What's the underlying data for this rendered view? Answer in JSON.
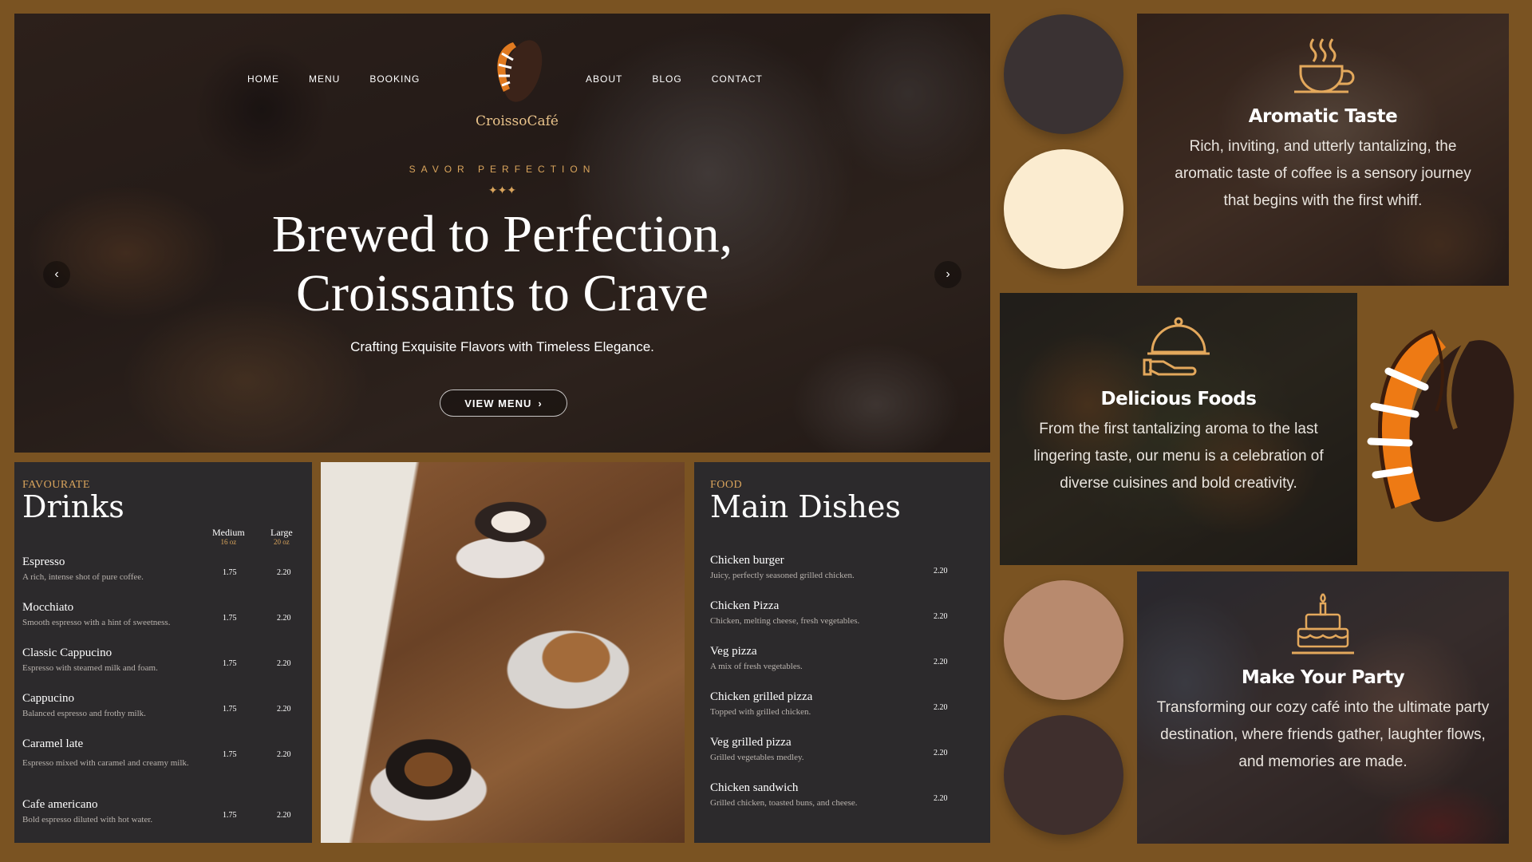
{
  "brand": {
    "name": "CroissoCafé"
  },
  "nav": {
    "left": [
      "HOME",
      "MENU",
      "BOOKING"
    ],
    "right": [
      "ABOUT",
      "BLOG",
      "CONTACT"
    ]
  },
  "hero": {
    "eyebrow": "SAVOR PERFECTION",
    "sparkle": "✦✦✦",
    "title_line1": "Brewed to Perfection,",
    "title_line2": "Croissants to Crave",
    "subtitle": "Crafting Exquisite Flavors with Timeless Elegance.",
    "button": "VIEW MENU",
    "button_arrow": "›",
    "prev_arrow": "‹",
    "next_arrow": "›"
  },
  "drinks": {
    "eyebrow": "FAVOURATE",
    "title": "Drinks",
    "sizes": [
      {
        "label": "Medium",
        "sub": "16 oz"
      },
      {
        "label": "Large",
        "sub": "20 oz"
      }
    ],
    "items": [
      {
        "name": "Espresso",
        "desc": "A rich, intense shot of pure coffee.",
        "medium": "1.75",
        "large": "2.20"
      },
      {
        "name": "Mocchiato",
        "desc": "Smooth espresso with a hint of sweetness.",
        "medium": "1.75",
        "large": "2.20"
      },
      {
        "name": "Classic Cappucino",
        "desc": "Espresso with steamed milk and foam.",
        "medium": "1.75",
        "large": "2.20"
      },
      {
        "name": "Cappucino",
        "desc": "Balanced espresso and frothy milk.",
        "medium": "1.75",
        "large": "2.20"
      },
      {
        "name": "Caramel late",
        "desc": "Espresso mixed with caramel and creamy milk.",
        "medium": "1.75",
        "large": "2.20"
      },
      {
        "name": "Cafe americano",
        "desc": "Bold espresso diluted with hot water.",
        "medium": "1.75",
        "large": "2.20"
      }
    ]
  },
  "mains": {
    "eyebrow": "FOOD",
    "title": "Main Dishes",
    "items": [
      {
        "name": "Chicken burger",
        "desc": "Juicy, perfectly seasoned grilled chicken.",
        "price": "2.20"
      },
      {
        "name": "Chicken Pizza",
        "desc": "Chicken, melting cheese, fresh vegetables.",
        "price": "2.20"
      },
      {
        "name": "Veg pizza",
        "desc": "A mix of fresh vegetables.",
        "price": "2.20"
      },
      {
        "name": "Chicken grilled pizza",
        "desc": "Topped with grilled chicken.",
        "price": "2.20"
      },
      {
        "name": "Veg grilled pizza",
        "desc": "Grilled vegetables medley.",
        "price": "2.20"
      },
      {
        "name": "Chicken sandwich",
        "desc": "Grilled chicken, toasted buns, and cheese.",
        "price": "2.20"
      }
    ]
  },
  "features": {
    "aroma": {
      "icon": "coffee-cup-icon",
      "title": "Aromatic Taste",
      "text": "Rich, inviting, and utterly tantalizing, the aromatic taste of coffee is a sensory journey that begins with the first whiff."
    },
    "foods": {
      "icon": "serving-cloche-icon",
      "title": "Delicious Foods",
      "text": "From the first tantalizing aroma to the last lingering taste, our menu is a celebration of diverse cuisines and bold creativity."
    },
    "party": {
      "icon": "birthday-cake-icon",
      "title": "Make Your Party",
      "text": "Transforming our cozy café into the ultimate party destination, where friends gather, laughter flows, and memories are made."
    }
  },
  "palette": {
    "background": "#7a5322",
    "swatches": [
      "#3a3233",
      "#fbecd0",
      "#b88a6e",
      "#3f2f2d"
    ],
    "accent": "#d9a45c",
    "panel": "#2c2a2c"
  }
}
